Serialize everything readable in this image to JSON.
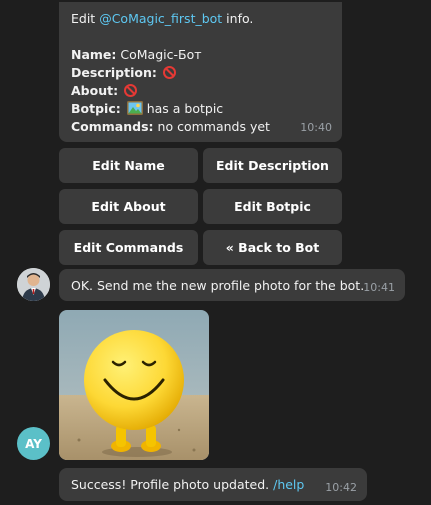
{
  "info_message": {
    "prefix": "Edit ",
    "bot_link": "@CoMagic_first_bot",
    "suffix": " info.",
    "name_label": "Name:",
    "name_value": "CoMagic-Бот",
    "description_label": "Description:",
    "about_label": "About:",
    "botpic_label": "Botpic:",
    "botpic_value": "has a botpic",
    "commands_label": "Commands:",
    "commands_value": "no commands yet",
    "time": "10:40"
  },
  "buttons": {
    "edit_name": "Edit Name",
    "edit_description": "Edit Description",
    "edit_about": "Edit About",
    "edit_botpic": "Edit Botpic",
    "edit_commands": "Edit Commands",
    "back_to_bot": "« Back to Bot"
  },
  "bot_reply": {
    "text": "OK. Send me the new profile photo for the bot.",
    "time": "10:41"
  },
  "user": {
    "initials": "AY",
    "avatar_color": "#5bc0c8"
  },
  "success_message": {
    "text": "Success! Profile photo updated.",
    "link": "/help",
    "time": "10:42"
  },
  "colors": {
    "background": "#1e1e1e",
    "bubble": "#3b3b3b",
    "link": "#5ec8f2"
  },
  "icons": {
    "description_status": "no-entry-icon",
    "about_status": "no-entry-icon",
    "botpic_status": "picture-icon"
  }
}
